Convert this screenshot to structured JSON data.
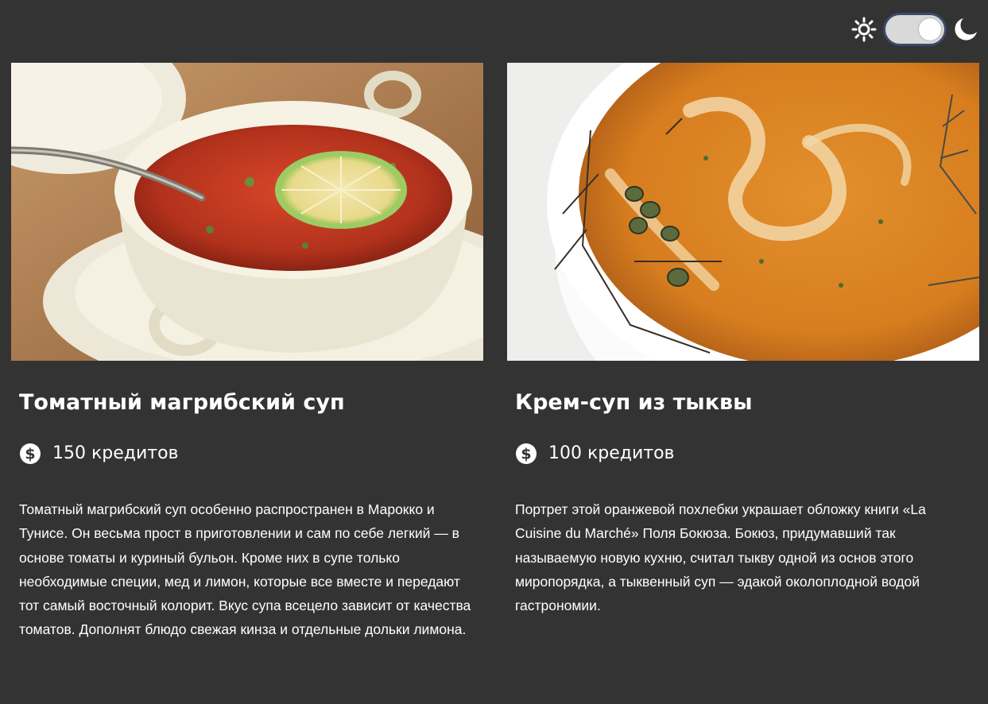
{
  "theme_switch": {
    "mode": "dark",
    "sun_icon": "sun-icon",
    "moon_icon": "moon-icon"
  },
  "colors": {
    "background": "#333333",
    "text": "#ffffff",
    "switch_track": "#d9d9d9",
    "switch_border": "#3a4a6b"
  },
  "cards": [
    {
      "title": "Томатный магрибский суп",
      "price": "150 кредитов",
      "price_icon": "dollar-coin-icon",
      "description": "Томатный магрибский суп особенно распространен в Марокко и Тунисе. Он весьма прост в приготовлении и сам по себе легкий — в основе томаты и куриный бульон. Кроме них в супе только необходимые специи, мед и лимон, которые все вместе и передают тот самый восточный колорит. Вкус супа всецело зависит от качества томатов. Дополнят блюдо свежая кинза и отдельные дольки лимона."
    },
    {
      "title": "Крем-суп из тыквы",
      "price": "100 кредитов",
      "price_icon": "dollar-coin-icon",
      "description": "Портрет этой оранжевой похлебки украшает обложку книги «La Cuisine du Marché» Поля Бокюза. Бокюз, придумавший так называемую новую кухню, считал тыкву одной из основ этого миропорядка, а тыквенный суп — эдакой околоплодной водой гастрономии."
    }
  ]
}
